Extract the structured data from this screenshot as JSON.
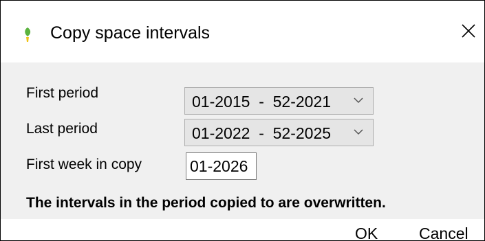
{
  "window": {
    "title": "Copy space intervals",
    "app_icon": "leaf-icon",
    "close_icon": "close-icon"
  },
  "form": {
    "first_period": {
      "label": "First period",
      "value": "01-2015  -  52-2021"
    },
    "last_period": {
      "label": "Last period",
      "value": "01-2022  -  52-2025"
    },
    "first_week_in_copy": {
      "label": "First week in copy",
      "value": "01-2026"
    },
    "warning": "The intervals in the period copied to are overwritten."
  },
  "buttons": {
    "ok": "OK",
    "cancel": "Cancel"
  },
  "colors": {
    "dialog_background": "#f0f0f0",
    "title_background": "#ffffff",
    "combobox_background": "#e5e5e5",
    "icon_green": "#5bb33f",
    "icon_yellow": "#f0c419"
  }
}
